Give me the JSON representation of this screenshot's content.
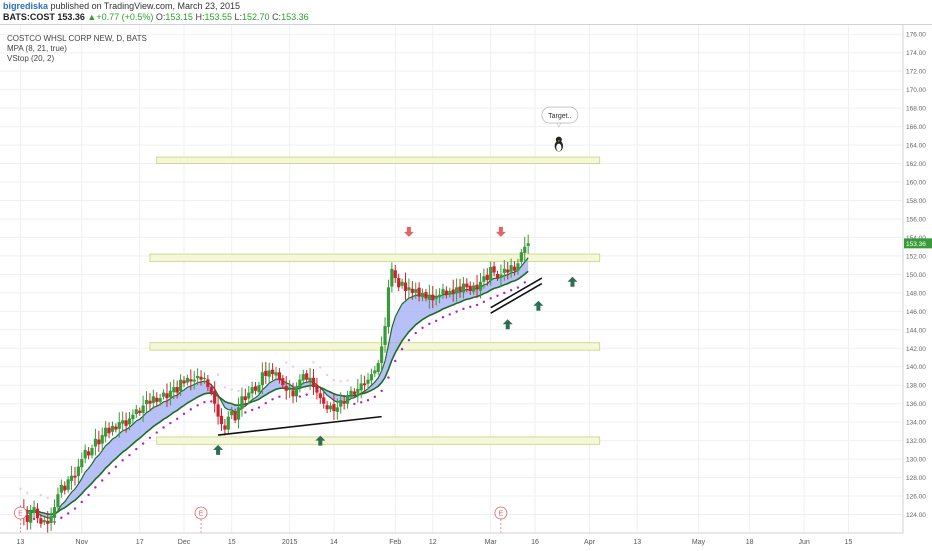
{
  "header": {
    "author": "bigrediska",
    "published": "published on TradingView.com, March 23, 2015",
    "symbol": "BATS:COST",
    "last": "153.36",
    "change": "+0.77 (+0.5%)",
    "open_label": "O:",
    "open": "153.15",
    "high_label": "H:",
    "high": "153.55",
    "low_label": "L:",
    "low": "152.70",
    "close_label": "C:",
    "close": "153.36"
  },
  "legend": {
    "title": "COSTCO WHSL CORP NEW, D, BATS",
    "indicator1": "MPA (8, 21, true)",
    "indicator2": "VStop (20, 2)"
  },
  "annotation": {
    "text": "Target.."
  },
  "colors": {
    "up_candle": "#3a9a3a",
    "down_candle": "#d0202b",
    "ma_line": "#1d6b2b",
    "ma_fill": "#9aa6f4",
    "stop_up": "#b41ec8",
    "stop_down": "#ecc9ec",
    "zone": "#f4f8d8",
    "zone_border": "#c9d27a",
    "arrow_up": "#2e6e53",
    "arrow_down": "#e06666",
    "price_tag": "#3a9a3a",
    "event": "#e06060"
  },
  "chart_data": {
    "type": "candlestick",
    "y_axis": {
      "min": 122,
      "max": 177,
      "side": "right",
      "ticks": [
        "124.00",
        "126.00",
        "128.00",
        "130.00",
        "132.00",
        "134.00",
        "136.00",
        "138.00",
        "140.00",
        "142.00",
        "144.00",
        "146.00",
        "148.00",
        "150.00",
        "152.00",
        "154.00",
        "156.00",
        "158.00",
        "160.00",
        "162.00",
        "164.00",
        "166.00",
        "168.00",
        "170.00",
        "172.00",
        "174.00",
        "176.00"
      ]
    },
    "x_axis": {
      "day_range": [
        -6,
        259
      ],
      "ticks": [
        {
          "day": 0,
          "label": "13"
        },
        {
          "day": 18,
          "label": "Nov"
        },
        {
          "day": 35,
          "label": "17"
        },
        {
          "day": 48,
          "label": "Dec"
        },
        {
          "day": 62,
          "label": "15"
        },
        {
          "day": 79,
          "label": "2015"
        },
        {
          "day": 92,
          "label": "14"
        },
        {
          "day": 110,
          "label": "Feb"
        },
        {
          "day": 121,
          "label": "12"
        },
        {
          "day": 138,
          "label": "Mar"
        },
        {
          "day": 151,
          "label": "16"
        },
        {
          "day": 167,
          "label": "Apr"
        },
        {
          "day": 181,
          "label": "13"
        },
        {
          "day": 199,
          "label": "May"
        },
        {
          "day": 214,
          "label": "18"
        },
        {
          "day": 230,
          "label": "Jun"
        },
        {
          "day": 243,
          "label": "15"
        }
      ]
    },
    "last_price": "153.36",
    "close_series": [
      {
        "day": 0,
        "close": 124.6
      },
      {
        "day": 1,
        "close": 123.8
      },
      {
        "day": 2,
        "close": 123.2
      },
      {
        "day": 3,
        "close": 124.2
      },
      {
        "day": 4,
        "close": 124.8
      },
      {
        "day": 5,
        "close": 123.6
      },
      {
        "day": 6,
        "close": 123.0
      },
      {
        "day": 7,
        "close": 123.4
      },
      {
        "day": 8,
        "close": 123.0
      },
      {
        "day": 9,
        "close": 123.8
      },
      {
        "day": 10,
        "close": 124.8
      },
      {
        "day": 11,
        "close": 126.2
      },
      {
        "day": 12,
        "close": 127.2
      },
      {
        "day": 13,
        "close": 126.6
      },
      {
        "day": 14,
        "close": 127.8
      },
      {
        "day": 15,
        "close": 128.2
      },
      {
        "day": 16,
        "close": 128.0
      },
      {
        "day": 17,
        "close": 129.2
      },
      {
        "day": 18,
        "close": 130.0
      },
      {
        "day": 19,
        "close": 131.0
      },
      {
        "day": 20,
        "close": 130.4
      },
      {
        "day": 21,
        "close": 131.2
      },
      {
        "day": 22,
        "close": 132.2
      },
      {
        "day": 23,
        "close": 131.6
      },
      {
        "day": 24,
        "close": 132.6
      },
      {
        "day": 25,
        "close": 133.4
      },
      {
        "day": 26,
        "close": 132.8
      },
      {
        "day": 27,
        "close": 133.6
      },
      {
        "day": 28,
        "close": 133.2
      },
      {
        "day": 29,
        "close": 134.0
      },
      {
        "day": 30,
        "close": 134.2
      },
      {
        "day": 31,
        "close": 133.6
      },
      {
        "day": 32,
        "close": 134.4
      },
      {
        "day": 33,
        "close": 134.8
      },
      {
        "day": 34,
        "close": 135.4
      },
      {
        "day": 35,
        "close": 135.0
      },
      {
        "day": 36,
        "close": 135.8
      },
      {
        "day": 37,
        "close": 136.4
      },
      {
        "day": 38,
        "close": 136.0
      },
      {
        "day": 39,
        "close": 136.8
      },
      {
        "day": 40,
        "close": 136.2
      },
      {
        "day": 41,
        "close": 136.6
      },
      {
        "day": 42,
        "close": 137.2
      },
      {
        "day": 43,
        "close": 136.6
      },
      {
        "day": 44,
        "close": 137.4
      },
      {
        "day": 45,
        "close": 137.8
      },
      {
        "day": 46,
        "close": 137.2
      },
      {
        "day": 47,
        "close": 138.6
      },
      {
        "day": 48,
        "close": 138.2
      },
      {
        "day": 49,
        "close": 138.8
      },
      {
        "day": 50,
        "close": 138.4
      },
      {
        "day": 51,
        "close": 138.6
      },
      {
        "day": 52,
        "close": 139.0
      },
      {
        "day": 53,
        "close": 138.6
      },
      {
        "day": 54,
        "close": 138.8
      },
      {
        "day": 55,
        "close": 137.8
      },
      {
        "day": 56,
        "close": 137.2
      },
      {
        "day": 57,
        "close": 136.0
      },
      {
        "day": 58,
        "close": 134.6
      },
      {
        "day": 59,
        "close": 133.8
      },
      {
        "day": 60,
        "close": 133.2
      },
      {
        "day": 61,
        "close": 134.6
      },
      {
        "day": 62,
        "close": 135.2
      },
      {
        "day": 63,
        "close": 134.2
      },
      {
        "day": 64,
        "close": 135.6
      },
      {
        "day": 65,
        "close": 136.8
      },
      {
        "day": 66,
        "close": 136.4
      },
      {
        "day": 67,
        "close": 137.2
      },
      {
        "day": 68,
        "close": 137.8
      },
      {
        "day": 69,
        "close": 137.4
      },
      {
        "day": 70,
        "close": 138.0
      },
      {
        "day": 71,
        "close": 139.4
      },
      {
        "day": 72,
        "close": 139.0
      },
      {
        "day": 73,
        "close": 139.6
      },
      {
        "day": 74,
        "close": 139.2
      },
      {
        "day": 75,
        "close": 139.4
      },
      {
        "day": 76,
        "close": 138.6
      },
      {
        "day": 77,
        "close": 138.0
      },
      {
        "day": 78,
        "close": 137.4
      },
      {
        "day": 79,
        "close": 137.6
      },
      {
        "day": 80,
        "close": 136.8
      },
      {
        "day": 81,
        "close": 137.6
      },
      {
        "day": 82,
        "close": 138.6
      },
      {
        "day": 83,
        "close": 139.2
      },
      {
        "day": 84,
        "close": 138.6
      },
      {
        "day": 85,
        "close": 138.8
      },
      {
        "day": 86,
        "close": 137.8
      },
      {
        "day": 87,
        "close": 137.2
      },
      {
        "day": 88,
        "close": 136.6
      },
      {
        "day": 89,
        "close": 136.0
      },
      {
        "day": 90,
        "close": 135.4
      },
      {
        "day": 91,
        "close": 135.8
      },
      {
        "day": 92,
        "close": 135.2
      },
      {
        "day": 93,
        "close": 135.6
      },
      {
        "day": 94,
        "close": 136.4
      },
      {
        "day": 95,
        "close": 136.0
      },
      {
        "day": 96,
        "close": 136.8
      },
      {
        "day": 97,
        "close": 137.4
      },
      {
        "day": 98,
        "close": 137.0
      },
      {
        "day": 99,
        "close": 137.6
      },
      {
        "day": 100,
        "close": 138.2
      },
      {
        "day": 101,
        "close": 138.0
      },
      {
        "day": 102,
        "close": 138.6
      },
      {
        "day": 103,
        "close": 139.2
      },
      {
        "day": 104,
        "close": 139.6
      },
      {
        "day": 105,
        "close": 140.4
      },
      {
        "day": 106,
        "close": 142.2
      },
      {
        "day": 107,
        "close": 144.4
      },
      {
        "day": 108,
        "close": 148.6
      },
      {
        "day": 109,
        "close": 150.6
      },
      {
        "day": 110,
        "close": 149.6
      },
      {
        "day": 111,
        "close": 148.6
      },
      {
        "day": 112,
        "close": 149.2
      },
      {
        "day": 113,
        "close": 148.2
      },
      {
        "day": 114,
        "close": 148.6
      },
      {
        "day": 115,
        "close": 148.0
      },
      {
        "day": 116,
        "close": 148.4
      },
      {
        "day": 117,
        "close": 147.6
      },
      {
        "day": 118,
        "close": 148.0
      },
      {
        "day": 119,
        "close": 147.4
      },
      {
        "day": 120,
        "close": 147.8
      },
      {
        "day": 121,
        "close": 147.2
      },
      {
        "day": 122,
        "close": 147.6
      },
      {
        "day": 123,
        "close": 147.8
      },
      {
        "day": 124,
        "close": 148.4
      },
      {
        "day": 125,
        "close": 147.8
      },
      {
        "day": 126,
        "close": 148.2
      },
      {
        "day": 127,
        "close": 148.0
      },
      {
        "day": 128,
        "close": 148.6
      },
      {
        "day": 129,
        "close": 148.2
      },
      {
        "day": 130,
        "close": 149.0
      },
      {
        "day": 131,
        "close": 148.6
      },
      {
        "day": 132,
        "close": 148.2
      },
      {
        "day": 133,
        "close": 148.8
      },
      {
        "day": 134,
        "close": 148.4
      },
      {
        "day": 135,
        "close": 149.2
      },
      {
        "day": 136,
        "close": 149.8
      },
      {
        "day": 137,
        "close": 149.4
      },
      {
        "day": 138,
        "close": 150.8
      },
      {
        "day": 139,
        "close": 150.2
      },
      {
        "day": 140,
        "close": 149.6
      },
      {
        "day": 141,
        "close": 150.0
      },
      {
        "day": 142,
        "close": 150.6
      },
      {
        "day": 143,
        "close": 150.2
      },
      {
        "day": 144,
        "close": 151.0
      },
      {
        "day": 145,
        "close": 150.4
      },
      {
        "day": 146,
        "close": 151.2
      },
      {
        "day": 147,
        "close": 152.4
      },
      {
        "day": 148,
        "close": 153.0
      },
      {
        "day": 149,
        "close": 153.36
      }
    ],
    "horizontal_zones": [
      {
        "low": 131.6,
        "high": 132.4,
        "from_day": 40,
        "to_day": 170
      },
      {
        "low": 141.8,
        "high": 142.6,
        "from_day": 38,
        "to_day": 170
      },
      {
        "low": 151.4,
        "high": 152.2,
        "from_day": 38,
        "to_day": 170
      },
      {
        "low": 162.0,
        "high": 162.7,
        "from_day": 40,
        "to_day": 170
      }
    ],
    "trendlines": [
      {
        "from": {
          "day": 58,
          "price": 132.6
        },
        "to": {
          "day": 106,
          "price": 134.6
        }
      },
      {
        "from": {
          "day": 138,
          "price": 145.8
        },
        "to": {
          "day": 153,
          "price": 149.0
        }
      },
      {
        "from": {
          "day": 138,
          "price": 146.4
        },
        "to": {
          "day": 153,
          "price": 149.6
        }
      }
    ],
    "signal_arrows": [
      {
        "day": 58,
        "price": 131.0,
        "dir": "up"
      },
      {
        "day": 88,
        "price": 132.0,
        "dir": "up"
      },
      {
        "day": 114,
        "price": 154.6,
        "dir": "down"
      },
      {
        "day": 141,
        "price": 154.6,
        "dir": "down"
      },
      {
        "day": 143,
        "price": 144.6,
        "dir": "up"
      },
      {
        "day": 152,
        "price": 146.6,
        "dir": "up"
      },
      {
        "day": 162,
        "price": 149.2,
        "dir": "up"
      }
    ],
    "event_markers": [
      {
        "day": 0
      },
      {
        "day": 53
      },
      {
        "day": 141
      }
    ],
    "marker": {
      "day": 158,
      "price": 164.0
    }
  }
}
